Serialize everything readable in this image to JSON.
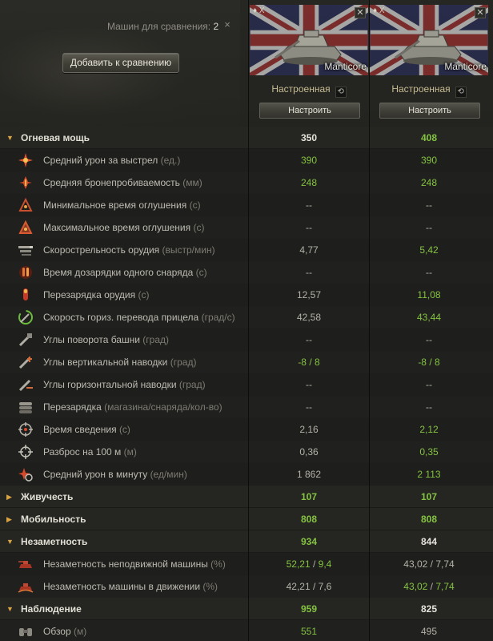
{
  "header": {
    "compare_label": "Машин для сравнения:",
    "compare_count": "2",
    "close_glyph": "×",
    "add_button": "Добавить к сравнению"
  },
  "vehicles": [
    {
      "tier": "♦ X",
      "name": "Manticore",
      "config_label": "Настроенная",
      "reset_glyph": "⟲",
      "configure_button": "Настроить",
      "remove_glyph": "✕"
    },
    {
      "tier": "♦ X",
      "name": "Manticore",
      "config_label": "Настроенная",
      "reset_glyph": "⟲",
      "configure_button": "Настроить",
      "remove_glyph": "✕"
    }
  ],
  "colors": {
    "accent_green": "#84c241",
    "chevron_orange": "#d9a441"
  },
  "groups": {
    "firepower": {
      "label": "Огневая мощь",
      "v1": "350",
      "v2": "408"
    },
    "survivability": {
      "label": "Живучесть",
      "v1": "107",
      "v2": "107"
    },
    "mobility": {
      "label": "Мобильность",
      "v1": "808",
      "v2": "808"
    },
    "concealment": {
      "label": "Незаметность",
      "v1": "934",
      "v2": "844"
    },
    "spotting": {
      "label": "Наблюдение",
      "v1": "959",
      "v2": "825"
    }
  },
  "stats": {
    "avg_damage": {
      "label": "Средний урон за выстрел",
      "unit": "(ед.)",
      "v1": "390",
      "v2": "390",
      "icon": "damage-icon"
    },
    "avg_penetration": {
      "label": "Средняя бронепробиваемость",
      "unit": "(мм)",
      "v1": "248",
      "v2": "248",
      "icon": "penetration-icon"
    },
    "min_stun": {
      "label": "Минимальное время оглушения",
      "unit": "(с)",
      "v1": "--",
      "v2": "--",
      "icon": "stun-min-icon"
    },
    "max_stun": {
      "label": "Максимальное время оглушения",
      "unit": "(с)",
      "v1": "--",
      "v2": "--",
      "icon": "stun-max-icon"
    },
    "rate_of_fire": {
      "label": "Скорострельность орудия",
      "unit": "(выстр/мин)",
      "v1": "4,77",
      "v2": "5,42",
      "icon": "rate-of-fire-icon"
    },
    "shell_reload": {
      "label": "Время дозарядки одного снаряда",
      "unit": "(с)",
      "v1": "--",
      "v2": "--",
      "icon": "shell-reload-icon"
    },
    "reload": {
      "label": "Перезарядка орудия",
      "unit": "(с)",
      "v1": "12,57",
      "v2": "11,08",
      "icon": "reload-icon"
    },
    "traverse_speed": {
      "label": "Скорость гориз. перевода прицела",
      "unit": "(град/с)",
      "v1": "42,58",
      "v2": "43,44",
      "icon": "traverse-icon"
    },
    "turret_angles": {
      "label": "Углы поворота башни",
      "unit": "(град)",
      "v1": "--",
      "v2": "--",
      "icon": "turret-angles-icon"
    },
    "vertical_angles": {
      "label": "Углы вертикальной наводки",
      "unit": "(град)",
      "v1": "-8 / 8",
      "v2": "-8 / 8",
      "icon": "elevation-icon"
    },
    "horizontal_angles": {
      "label": "Углы горизонтальной наводки",
      "unit": "(град)",
      "v1": "--",
      "v2": "--",
      "icon": "horizontal-aim-icon"
    },
    "magazine_reload": {
      "label": "Перезарядка",
      "unit": "(магазина/снаряда/кол-во)",
      "v1": "--",
      "v2": "--",
      "icon": "magazine-icon"
    },
    "aim_time": {
      "label": "Время сведения",
      "unit": "(с)",
      "v1": "2,16",
      "v2": "2,12",
      "icon": "aim-time-icon"
    },
    "dispersion": {
      "label": "Разброс на 100 м",
      "unit": "(м)",
      "v1": "0,36",
      "v2": "0,35",
      "icon": "crosshair-icon"
    },
    "dpm": {
      "label": "Средний урон в минуту",
      "unit": "(ед/мин)",
      "v1": "1 862",
      "v2": "2 113",
      "icon": "dpm-icon"
    },
    "camo_stationary": {
      "label": "Незаметность неподвижной машины",
      "unit": "(%)",
      "v1a": "52,21",
      "v1b": "9,4",
      "v2a": "43,02",
      "v2b": "7,74",
      "sep": " / ",
      "icon": "camo-stationary-icon"
    },
    "camo_moving": {
      "label": "Незаметность машины в движении",
      "unit": "(%)",
      "v1a": "42,21",
      "v1b": "7,6",
      "v2a": "43,02",
      "v2b": "7,74",
      "sep": " / ",
      "icon": "camo-moving-icon"
    },
    "view_range": {
      "label": "Обзор",
      "unit": "(м)",
      "v1": "551",
      "v2": "495",
      "icon": "view-range-icon"
    }
  }
}
